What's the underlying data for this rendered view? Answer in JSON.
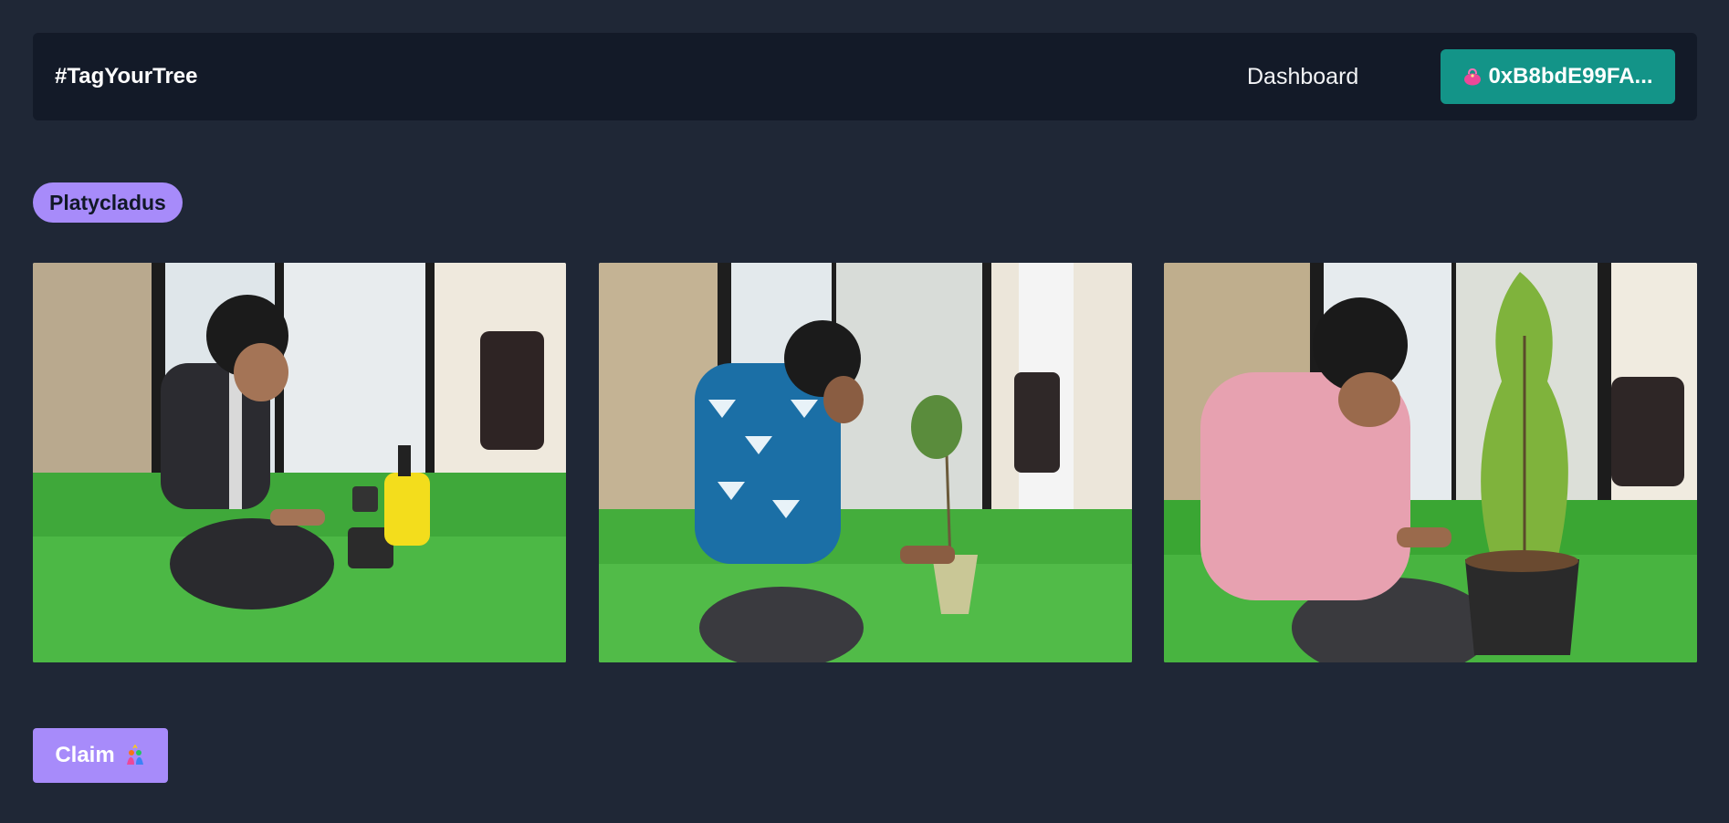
{
  "navbar": {
    "brand": "#TagYourTree",
    "dashboard_label": "Dashboard",
    "wallet_label": "0xB8bdE99FA...",
    "wallet_icon": "purse-icon",
    "wallet_color": "#139488"
  },
  "tree": {
    "species": "Platycladus",
    "badge_color": "#a78bfa"
  },
  "photos": [
    {
      "name": "photo-planting-1"
    },
    {
      "name": "photo-planting-2"
    },
    {
      "name": "photo-planting-3"
    }
  ],
  "actions": {
    "claim_label": "Claim",
    "claim_icon": "sparkle-hands-icon",
    "claim_color": "#a78bfa"
  }
}
